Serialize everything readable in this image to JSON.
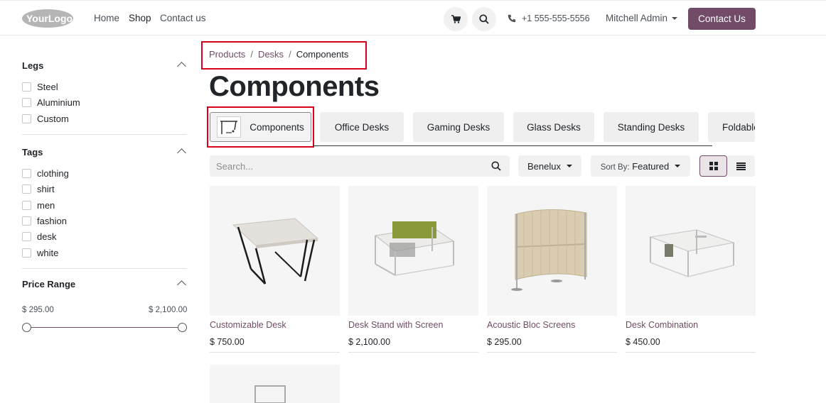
{
  "header": {
    "logo_text": "YourLogo",
    "nav": [
      "Home",
      "Shop",
      "Contact us"
    ],
    "active_nav": "Shop",
    "phone": "+1 555-555-5556",
    "user": "Mitchell Admin",
    "cta": "Contact Us",
    "accent": "#714b67"
  },
  "sidebar": {
    "legs": {
      "title": "Legs",
      "options": [
        "Steel",
        "Aluminium",
        "Custom"
      ]
    },
    "tags": {
      "title": "Tags",
      "options": [
        "clothing",
        "shirt",
        "men",
        "fashion",
        "desk",
        "white"
      ]
    },
    "price": {
      "title": "Price Range",
      "min_label": "$ 295.00",
      "max_label": "$ 2,100.00"
    }
  },
  "main": {
    "breadcrumb": [
      "Products",
      "Desks",
      "Components"
    ],
    "title": "Components",
    "categories": [
      "Components",
      "Office Desks",
      "Gaming Desks",
      "Glass Desks",
      "Standing Desks",
      "Foldable"
    ],
    "active_category": "Components",
    "search_placeholder": "Search...",
    "pricelist": "Benelux",
    "sort_prefix": "Sort By:",
    "sort_value": "Featured"
  },
  "products": [
    {
      "name": "Customizable Desk",
      "price": "$ 750.00"
    },
    {
      "name": "Desk Stand with Screen",
      "price": "$ 2,100.00"
    },
    {
      "name": "Acoustic Bloc Screens",
      "price": "$ 295.00"
    },
    {
      "name": "Desk Combination",
      "price": "$ 450.00"
    }
  ]
}
